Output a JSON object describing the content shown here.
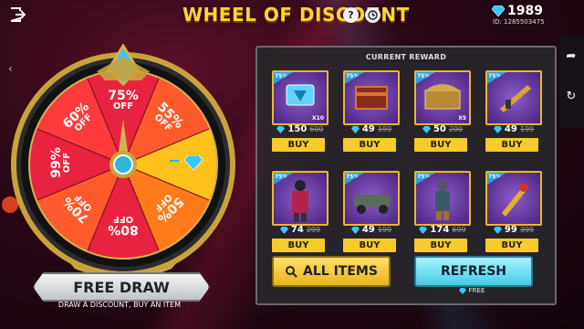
{
  "header": {
    "title": "WHEEL OF DISCOUNT",
    "help_icon": "?",
    "diamonds": "1989",
    "user_id": "ID: 1285503475"
  },
  "colors": {
    "gold": "#ffd23a",
    "wheel_red": "#e8233f",
    "wheel_orange": "#ff7a1a",
    "wheel_yellow": "#ffc21c",
    "buy_yellow": "#f7cb2a",
    "refresh_cyan": "#46c9e8"
  },
  "wheel": {
    "segments": [
      {
        "text": "75%",
        "sub": "OFF"
      },
      {
        "text": "55%",
        "sub": "OFF"
      },
      {
        "text": "",
        "sub": ""
      },
      {
        "text": "50%",
        "sub": "OFF"
      },
      {
        "text": "80%",
        "sub": "OFF"
      },
      {
        "text": "70%",
        "sub": "OFF"
      },
      {
        "text": "99%",
        "sub": "OFF"
      },
      {
        "text": "60%",
        "sub": "OFF"
      }
    ]
  },
  "free_draw": {
    "label": "FREE DRAW",
    "subtitle": "DRAW A DISCOUNT, BUY AN ITEM"
  },
  "reward_panel": {
    "title": "CURRENT REWARD",
    "items": [
      {
        "badge": "75%",
        "qty": "X10",
        "price": "150",
        "old_price": "600",
        "buy": "BUY",
        "icon": "voucher-icon"
      },
      {
        "badge": "75%",
        "qty": "",
        "price": "49",
        "old_price": "199",
        "buy": "BUY",
        "icon": "crate-icon"
      },
      {
        "badge": "75%",
        "qty": "X5",
        "price": "50",
        "old_price": "200",
        "buy": "BUY",
        "icon": "chest-icon"
      },
      {
        "badge": "75%",
        "qty": "",
        "price": "49",
        "old_price": "199",
        "buy": "BUY",
        "icon": "weapon-skin-icon"
      },
      {
        "badge": "75%",
        "qty": "",
        "price": "74",
        "old_price": "299",
        "buy": "BUY",
        "icon": "outfit-icon"
      },
      {
        "badge": "75%",
        "qty": "",
        "price": "49",
        "old_price": "199",
        "buy": "BUY",
        "icon": "vehicle-icon"
      },
      {
        "badge": "75%",
        "qty": "",
        "price": "174",
        "old_price": "699",
        "buy": "BUY",
        "icon": "character-icon"
      },
      {
        "badge": "75%",
        "qty": "",
        "price": "99",
        "old_price": "399",
        "buy": "BUY",
        "icon": "melee-icon"
      }
    ],
    "all_items": "ALL ITEMS",
    "refresh": "REFRESH",
    "refresh_cost": "FREE"
  }
}
